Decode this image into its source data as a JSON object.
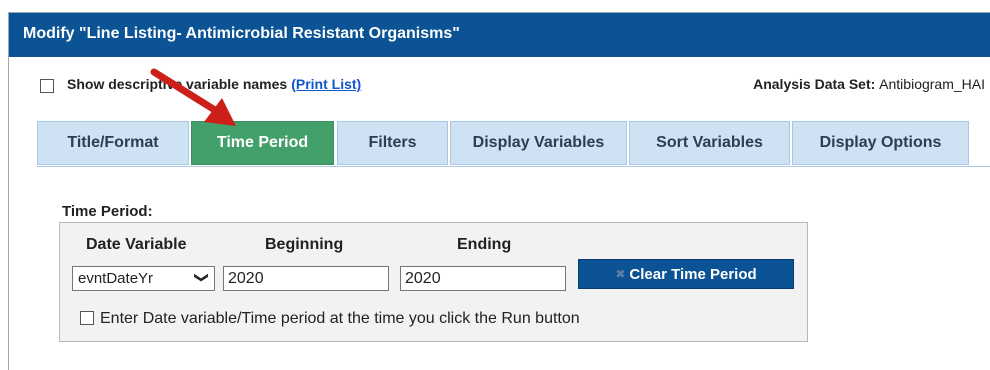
{
  "window": {
    "title": "Modify \"Line Listing- Antimicrobial Resistant Organisms\""
  },
  "options": {
    "show_descriptive_label": "Show descriptive variable names",
    "print_list_link": "(Print List)",
    "dataset_label": "Analysis Data Set:",
    "dataset_value": "Antibiogram_HAI"
  },
  "tabs": [
    {
      "label": "Title/Format"
    },
    {
      "label": "Time Period",
      "active": true
    },
    {
      "label": "Filters"
    },
    {
      "label": "Display Variables"
    },
    {
      "label": "Sort Variables"
    },
    {
      "label": "Display Options"
    }
  ],
  "time_period": {
    "section_title": "Time Period:",
    "date_variable_header": "Date Variable",
    "beginning_header": "Beginning",
    "ending_header": "Ending",
    "date_variable_value": "evntDateYr",
    "beginning_value": "2020",
    "ending_value": "2020",
    "clear_button": "Clear Time Period",
    "run_option_label": "Enter Date variable/Time period at the time you click the Run button"
  },
  "colors": {
    "title_bar": "#0b5394",
    "active_tab": "#44a06a",
    "inactive_tab": "#cfe2f3",
    "arrow": "#cc1f1a"
  },
  "icons": {
    "select_chevron": "chevron-down-icon",
    "clear": "clear-icon",
    "annotation": "red-arrow"
  }
}
